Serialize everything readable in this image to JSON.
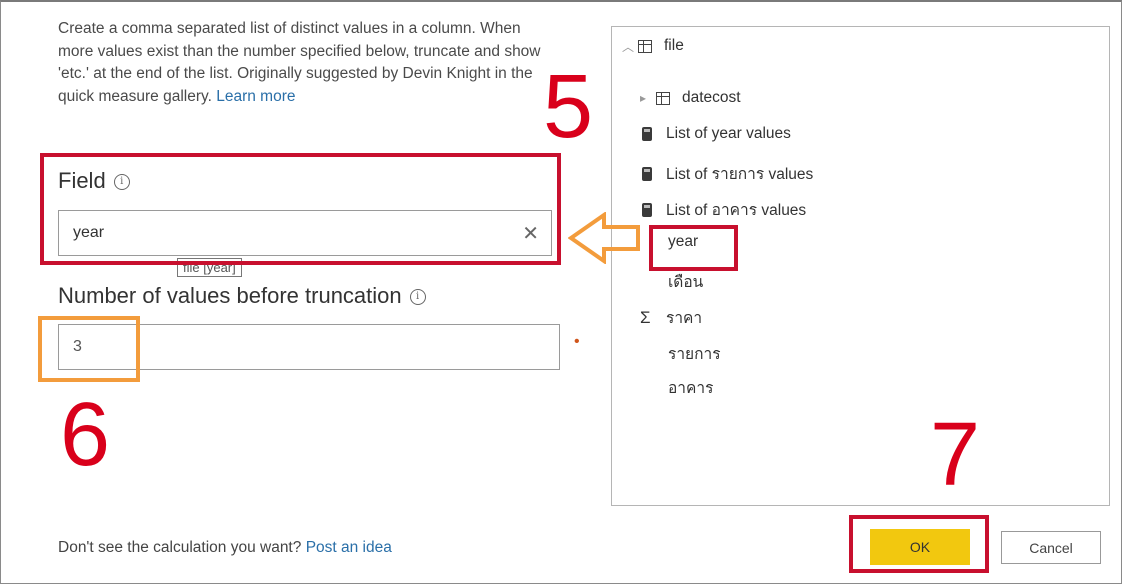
{
  "dialog": {
    "description": "Create a comma separated list of distinct values in a column. When more values exist than the number specified below, truncate and show 'etc.' at the end of the list. Originally suggested by Devin Knight in the quick measure gallery.",
    "learn_more": "Learn more",
    "field_label": "Field",
    "field_value": "year",
    "field_tooltip": "file [year]",
    "truncation_label": "Number of values before truncation",
    "truncation_value": "3",
    "footer_text": "Don't see the calculation you want?",
    "footer_link": "Post an idea",
    "ok_label": "OK",
    "cancel_label": "Cancel"
  },
  "fields_panel": {
    "table_name": "file",
    "items": [
      {
        "label": "datecost",
        "icon": "table-icon",
        "expandable": true
      },
      {
        "label": "List of year values",
        "icon": "calculator-icon"
      },
      {
        "label": "List of รายการ values",
        "icon": "calculator-icon"
      },
      {
        "label": "List of อาคาร values",
        "icon": "calculator-icon"
      },
      {
        "label": "year",
        "icon": "none"
      },
      {
        "label": "เดือน",
        "icon": "none"
      },
      {
        "label": "ราคา",
        "icon": "sigma-icon"
      },
      {
        "label": "รายการ",
        "icon": "none"
      },
      {
        "label": "อาคาร",
        "icon": "none"
      }
    ]
  },
  "annotations": {
    "step_5": "5",
    "step_6": "6",
    "step_7": "7"
  },
  "colors": {
    "annotation_red": "#c8102e",
    "annotation_orange": "#f39c3c",
    "ok_button": "#f2c80f",
    "link": "#2a6fa8"
  }
}
